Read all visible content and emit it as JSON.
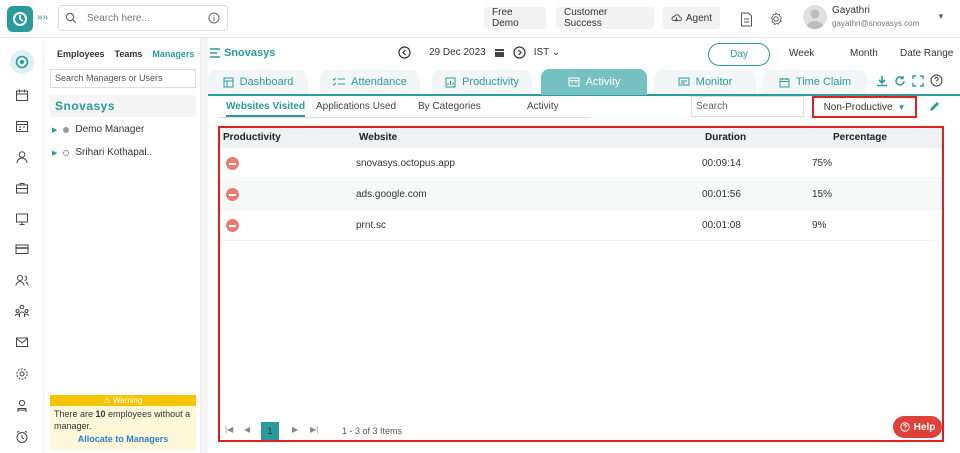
{
  "search": {
    "placeholder": "Search here..."
  },
  "topbar": {
    "free_demo": "Free Demo",
    "customer_success": "Customer Success",
    "agent": "Agent",
    "user_name": "Gayathri",
    "user_email": "gayathri@snovasys.com"
  },
  "sidebar": {
    "tabs": [
      "Employees",
      "Teams",
      "Managers"
    ],
    "search_placeholder": "Search Managers or Users",
    "org": "Snovasys",
    "managers": [
      {
        "name": "Demo Manager",
        "status": "filled"
      },
      {
        "name": "Srihari Kothapal..",
        "status": "hollow"
      }
    ],
    "warning": {
      "title": "Warning",
      "text_pre": "There are ",
      "count": "10",
      "text_post": " employees without a manager.",
      "link": "Allocate to Managers"
    }
  },
  "main": {
    "org": "Snovasys",
    "date": "29 Dec 2023",
    "timezone": "IST",
    "ranges": [
      "Day",
      "Week",
      "Month",
      "Date Range"
    ],
    "tabs": [
      "Dashboard",
      "Attendance",
      "Productivity",
      "Activity",
      "Monitor",
      "Time Claim"
    ],
    "active_tab": "Activity",
    "subtabs": [
      "Websites Visited",
      "Applications Used",
      "By Categories",
      "Activity"
    ],
    "search_placeholder": "Search",
    "filter": "Non-Productive",
    "table": {
      "headers": [
        "Productivity",
        "Website",
        "Duration",
        "Percentage"
      ],
      "rows": [
        {
          "website": "snovasys.octopus.app",
          "duration": "00:09:14",
          "percentage": "75%"
        },
        {
          "website": "ads.google.com",
          "duration": "00:01:56",
          "percentage": "15%"
        },
        {
          "website": "prnt.sc",
          "duration": "00:01:08",
          "percentage": "9%"
        }
      ]
    },
    "pager": {
      "current": "1",
      "summary": "1 - 3 of 3 Items"
    },
    "help": "Help"
  },
  "colors": {
    "accent": "#2b9a9a",
    "highlight": "#e02020",
    "nonproductive": "#e97b72"
  }
}
